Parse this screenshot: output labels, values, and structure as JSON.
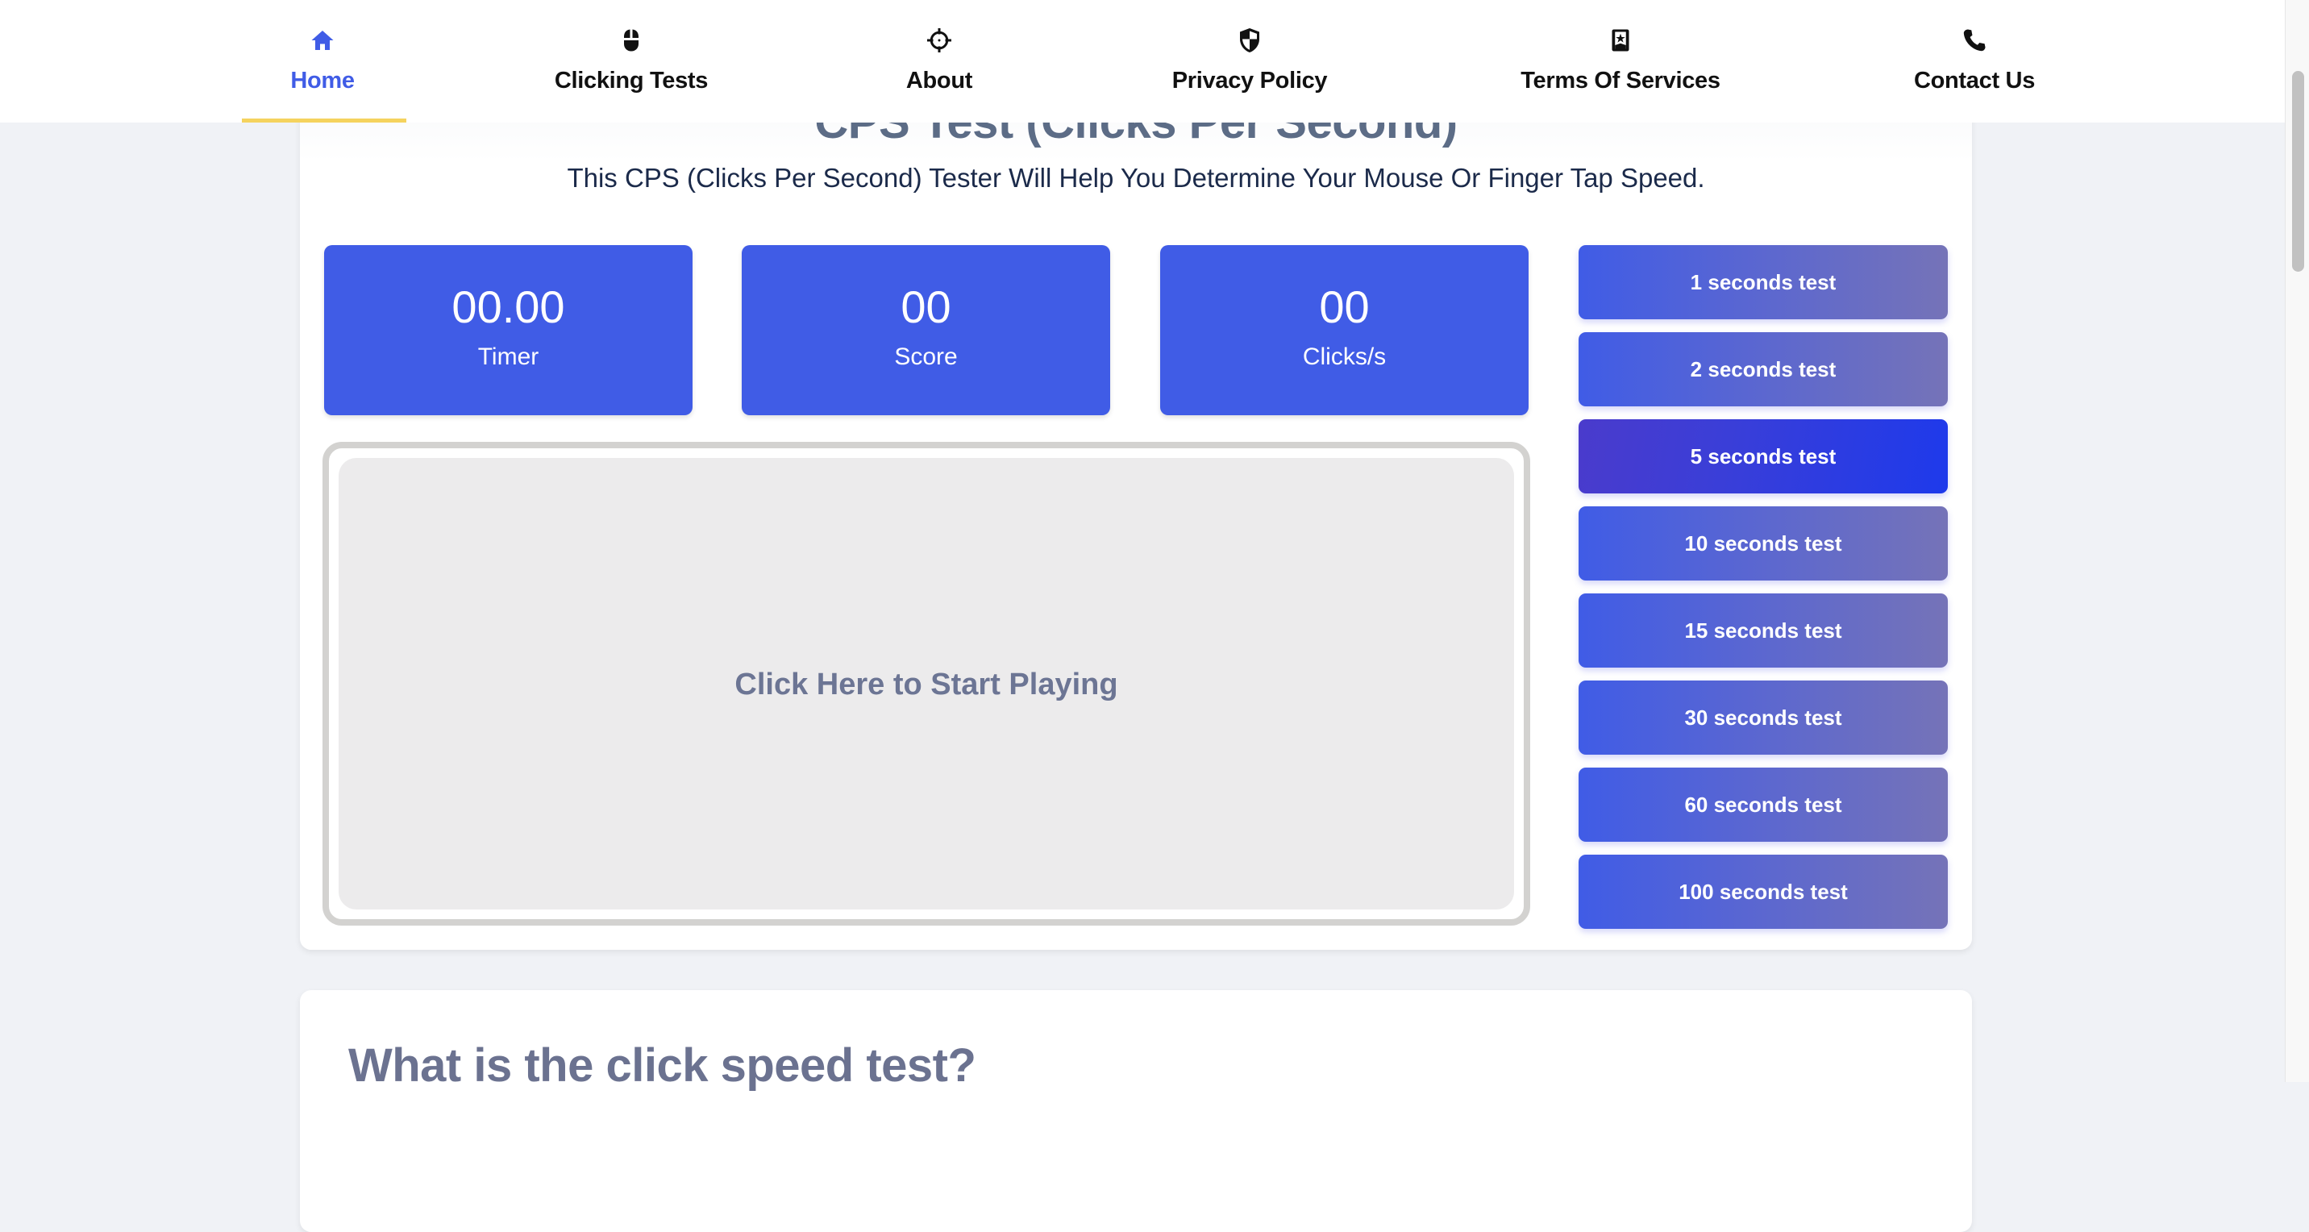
{
  "nav": {
    "items": [
      {
        "label": "Home",
        "icon": "home-icon",
        "active": true
      },
      {
        "label": "Clicking Tests",
        "icon": "mouse-icon",
        "active": false
      },
      {
        "label": "About",
        "icon": "crosshair-icon",
        "active": false
      },
      {
        "label": "Privacy Policy",
        "icon": "shield-icon",
        "active": false
      },
      {
        "label": "Terms Of Services",
        "icon": "bookmark-star-icon",
        "active": false
      },
      {
        "label": "Contact Us",
        "icon": "phone-icon",
        "active": false
      }
    ],
    "active_color": "#405ce6",
    "underline_color": "#f5d35e"
  },
  "main": {
    "title": "CPS Test (Clicks Per Second)",
    "subtitle": "This CPS (Clicks Per Second) Tester Will Help You Determine Your Mouse Or Finger Tap Speed.",
    "stats": [
      {
        "value": "00.00",
        "label": "Timer"
      },
      {
        "value": "00",
        "label": "Score"
      },
      {
        "value": "00",
        "label": "Clicks/s"
      }
    ],
    "play_area_text": "Click Here to Start Playing",
    "tests": [
      {
        "label": "1 seconds test",
        "active": false
      },
      {
        "label": "2 seconds test",
        "active": false
      },
      {
        "label": "5 seconds test",
        "active": true
      },
      {
        "label": "10 seconds test",
        "active": false
      },
      {
        "label": "15 seconds test",
        "active": false
      },
      {
        "label": "30 seconds test",
        "active": false
      },
      {
        "label": "60 seconds test",
        "active": false
      },
      {
        "label": "100 seconds test",
        "active": false
      }
    ],
    "stat_color": "#405ce6"
  },
  "info": {
    "heading": "What is the click speed test?"
  }
}
